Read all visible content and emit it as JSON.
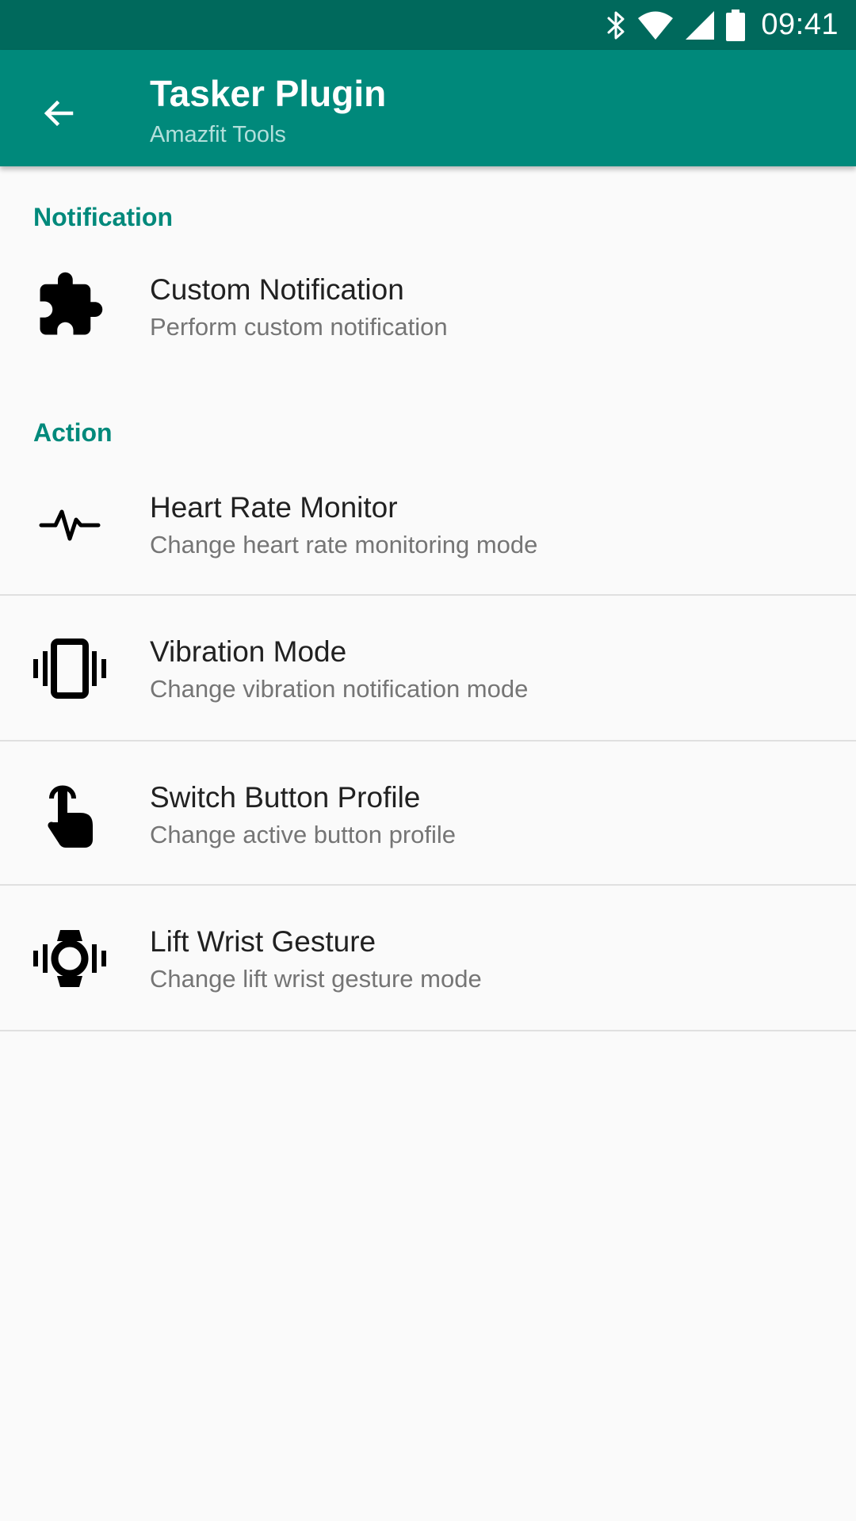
{
  "status_bar": {
    "time": "09:41",
    "icons": [
      "bluetooth-icon",
      "wifi-icon",
      "signal-icon",
      "battery-icon"
    ]
  },
  "app_bar": {
    "back_icon": "arrow-back-icon",
    "title": "Tasker Plugin",
    "subtitle": "Amazfit Tools"
  },
  "sections": [
    {
      "header": "Notification",
      "items": [
        {
          "icon": "puzzle-icon",
          "title": "Custom Notification",
          "summary": "Perform custom notification"
        }
      ]
    },
    {
      "header": "Action",
      "items": [
        {
          "icon": "heart-rate-icon",
          "title": "Heart Rate Monitor",
          "summary": "Change heart rate monitoring mode"
        },
        {
          "icon": "vibration-icon",
          "title": "Vibration Mode",
          "summary": "Change vibration notification mode"
        },
        {
          "icon": "touch-icon",
          "title": "Switch Button Profile",
          "summary": "Change active button profile"
        },
        {
          "icon": "watch-vibration-icon",
          "title": "Lift Wrist Gesture",
          "summary": "Change lift wrist gesture mode"
        }
      ]
    }
  ],
  "colors": {
    "status_bar": "#00695c",
    "app_bar": "#00897b",
    "accent": "#00897b",
    "background": "#fafafa",
    "title_text": "#212121",
    "summary_text": "#757575",
    "divider": "#e0e0e0"
  }
}
